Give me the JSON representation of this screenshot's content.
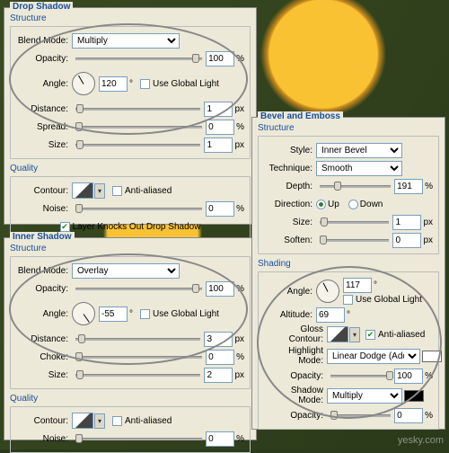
{
  "dropShadow": {
    "title": "Drop Shadow",
    "structure": "Structure",
    "quality": "Quality",
    "blendModeLabel": "Blend Mode:",
    "blendMode": "Multiply",
    "opacityLabel": "Opacity:",
    "opacity": "100",
    "angleLabel": "Angle:",
    "angle": "120",
    "useGlobal": "Use Global Light",
    "distanceLabel": "Distance:",
    "distance": "1",
    "spreadLabel": "Spread:",
    "spread": "0",
    "sizeLabel": "Size:",
    "size": "1",
    "contourLabel": "Contour:",
    "antiAliased": "Anti-aliased",
    "noiseLabel": "Noise:",
    "noise": "0",
    "knockout": "Layer Knocks Out Drop Shadow",
    "px": "px",
    "pct": "%",
    "deg": "°"
  },
  "innerShadow": {
    "title": "Inner Shadow",
    "structure": "Structure",
    "quality": "Quality",
    "blendModeLabel": "Blend Mode:",
    "blendMode": "Overlay",
    "opacityLabel": "Opacity:",
    "opacity": "100",
    "angleLabel": "Angle:",
    "angle": "-55",
    "useGlobal": "Use Global Light",
    "distanceLabel": "Distance:",
    "distance": "3",
    "chokeLabel": "Choke:",
    "choke": "0",
    "sizeLabel": "Size:",
    "size": "2",
    "contourLabel": "Contour:",
    "antiAliased": "Anti-aliased",
    "noiseLabel": "Noise:",
    "noise": "0",
    "px": "px",
    "pct": "%",
    "deg": "°"
  },
  "bevel": {
    "title": "Bevel and Emboss",
    "structure": "Structure",
    "shading": "Shading",
    "styleLabel": "Style:",
    "style": "Inner Bevel",
    "techniqueLabel": "Technique:",
    "technique": "Smooth",
    "depthLabel": "Depth:",
    "depth": "191",
    "directionLabel": "Direction:",
    "up": "Up",
    "down": "Down",
    "sizeLabel": "Size:",
    "size": "1",
    "softenLabel": "Soften:",
    "soften": "0",
    "angleLabel": "Angle:",
    "angle": "117",
    "useGlobal": "Use Global Light",
    "altitudeLabel": "Altitude:",
    "altitude": "69",
    "glossLabel": "Gloss Contour:",
    "antiAliased": "Anti-aliased",
    "hlModeLabel": "Highlight Mode:",
    "hlMode": "Linear Dodge (Add)",
    "hlOpacityLabel": "Opacity:",
    "hlOpacity": "100",
    "shModeLabel": "Shadow Mode:",
    "shMode": "Multiply",
    "shOpacityLabel": "Opacity:",
    "shOpacity": "0",
    "px": "px",
    "pct": "%",
    "deg": "°"
  },
  "watermark": "yesky.com"
}
